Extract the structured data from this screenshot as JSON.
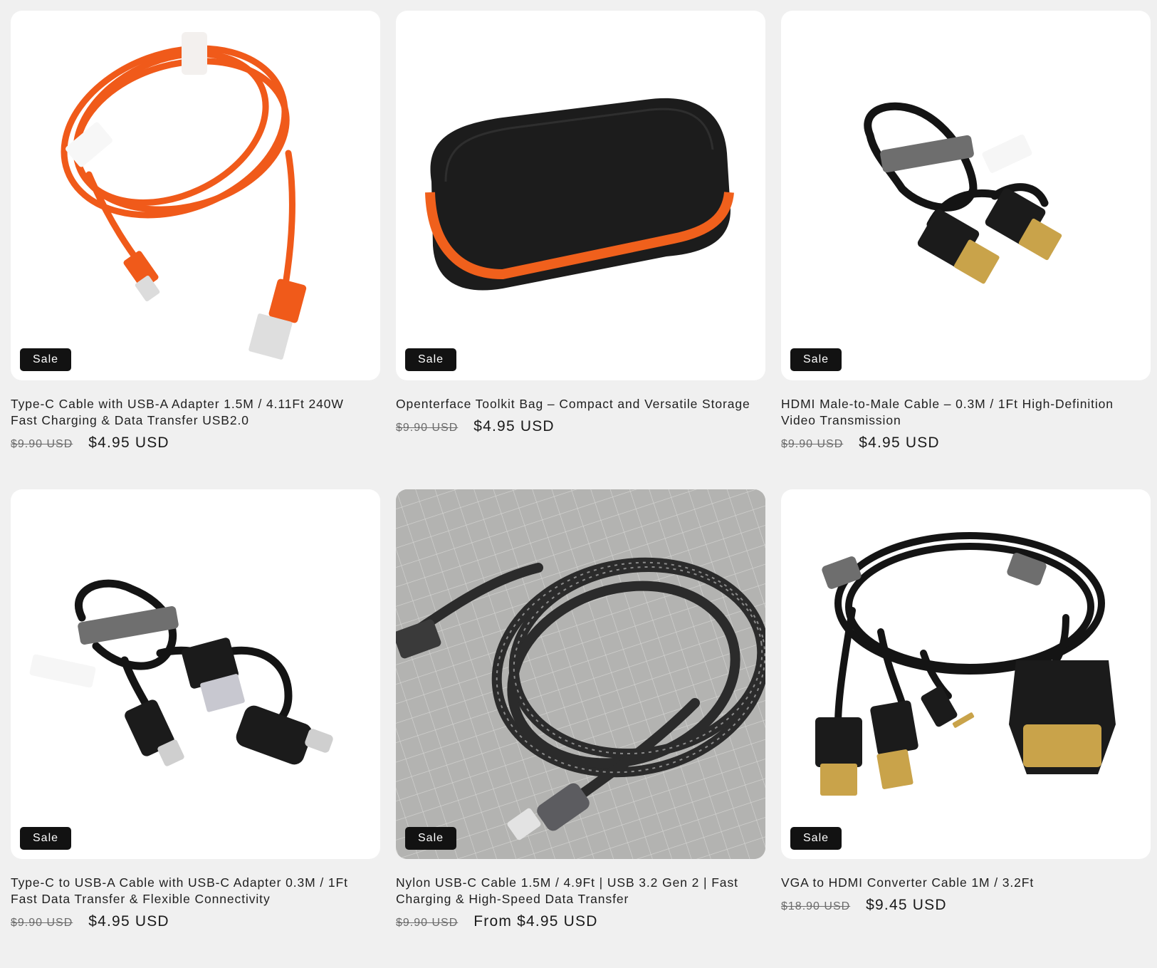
{
  "badge_label": "Sale",
  "products": [
    {
      "title": "Type-C Cable with USB-A Adapter 1.5M / 4.11Ft 240W Fast Charging & Data Transfer USB2.0",
      "compare_price": "$9.90 USD",
      "price": "$4.95 USD",
      "image": "orange-usb-c-cable"
    },
    {
      "title": "Openterface Toolkit Bag – Compact and Versatile Storage",
      "compare_price": "$9.90 USD",
      "price": "$4.95 USD",
      "image": "black-zip-case"
    },
    {
      "title": "HDMI Male-to-Male Cable – 0.3M / 1Ft High-Definition Video Transmission",
      "compare_price": "$9.90 USD",
      "price": "$4.95 USD",
      "image": "short-hdmi-cable"
    },
    {
      "title": "Type-C to USB-A Cable with USB-C Adapter 0.3M / 1Ft Fast Data Transfer & Flexible Connectivity",
      "compare_price": "$9.90 USD",
      "price": "$4.95 USD",
      "image": "usb-c-cable-with-adapter"
    },
    {
      "title": "Nylon USB-C Cable 1.5M / 4.9Ft | USB 3.2 Gen 2 | Fast Charging & High-Speed Data Transfer",
      "compare_price": "$9.90 USD",
      "price": "From $4.95 USD",
      "image": "braided-usb-c-cable"
    },
    {
      "title": "VGA to HDMI Converter Cable 1M / 3.2Ft",
      "compare_price": "$18.90 USD",
      "price": "$9.45 USD",
      "image": "vga-hdmi-converter-cable"
    }
  ],
  "colors": {
    "page_bg": "#f0f0f0",
    "badge_bg": "#121212",
    "cable_orange": "#f05a1a"
  }
}
